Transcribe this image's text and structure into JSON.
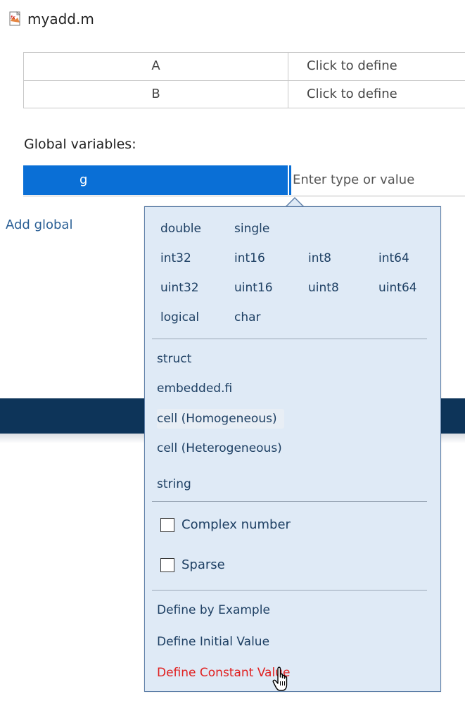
{
  "file": {
    "name": "myadd.m",
    "icon": "matlab-function-file-icon"
  },
  "inputs": [
    {
      "name": "A",
      "type": "Click to define"
    },
    {
      "name": "B",
      "type": "Click to define"
    }
  ],
  "globals": {
    "label": "Global variables:",
    "name": "g",
    "type_placeholder": "Enter type or value",
    "add_label": "Add global"
  },
  "popup": {
    "numeric_types": [
      [
        "double",
        "single"
      ],
      [
        "int32",
        "int16",
        "int8",
        "int64"
      ],
      [
        "uint32",
        "uint16",
        "uint8",
        "uint64"
      ],
      [
        "logical",
        "char"
      ]
    ],
    "class_types": [
      "struct",
      "embedded.fi",
      "cell (Homogeneous)",
      "cell (Heterogeneous)",
      "string"
    ],
    "options": [
      "Complex number",
      "Sparse"
    ],
    "actions": [
      "Define by Example",
      "Define Initial Value",
      "Define Constant Value"
    ],
    "hovered_item": "cell (Homogeneous)",
    "highlight_action": "Define Constant Value"
  },
  "colors": {
    "selection": "#0a6fd6",
    "popup_bg": "#dfeaf6",
    "link": "#1d3f63",
    "highlight": "#e02020",
    "dark_band": "#0d3459"
  }
}
